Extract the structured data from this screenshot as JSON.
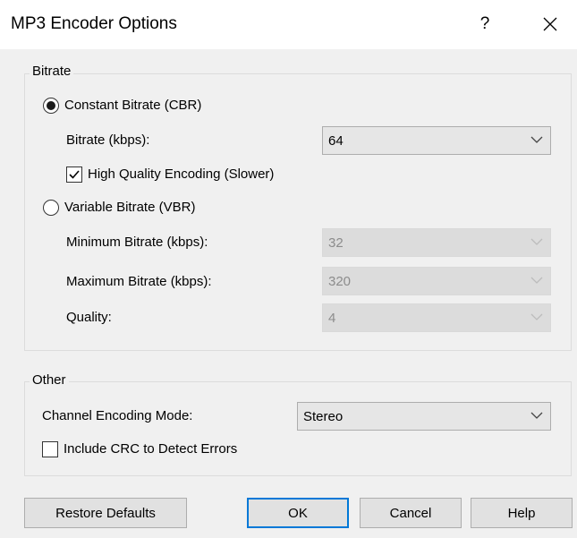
{
  "window": {
    "title": "MP3 Encoder Options",
    "help_label": "?"
  },
  "bitrate_group": {
    "legend": "Bitrate",
    "cbr_label": "Constant Bitrate (CBR)",
    "bitrate_label": "Bitrate (kbps):",
    "bitrate_value": "64",
    "high_quality_label": "High Quality Encoding (Slower)",
    "vbr_label": "Variable Bitrate (VBR)",
    "min_label": "Minimum Bitrate (kbps):",
    "min_value": "32",
    "max_label": "Maximum Bitrate (kbps):",
    "max_value": "320",
    "quality_label": "Quality:",
    "quality_value": "4"
  },
  "other_group": {
    "legend": "Other",
    "channel_label": "Channel Encoding Mode:",
    "channel_value": "Stereo",
    "crc_label": "Include CRC to Detect Errors"
  },
  "buttons": {
    "restore": "Restore Defaults",
    "ok": "OK",
    "cancel": "Cancel",
    "help": "Help"
  }
}
